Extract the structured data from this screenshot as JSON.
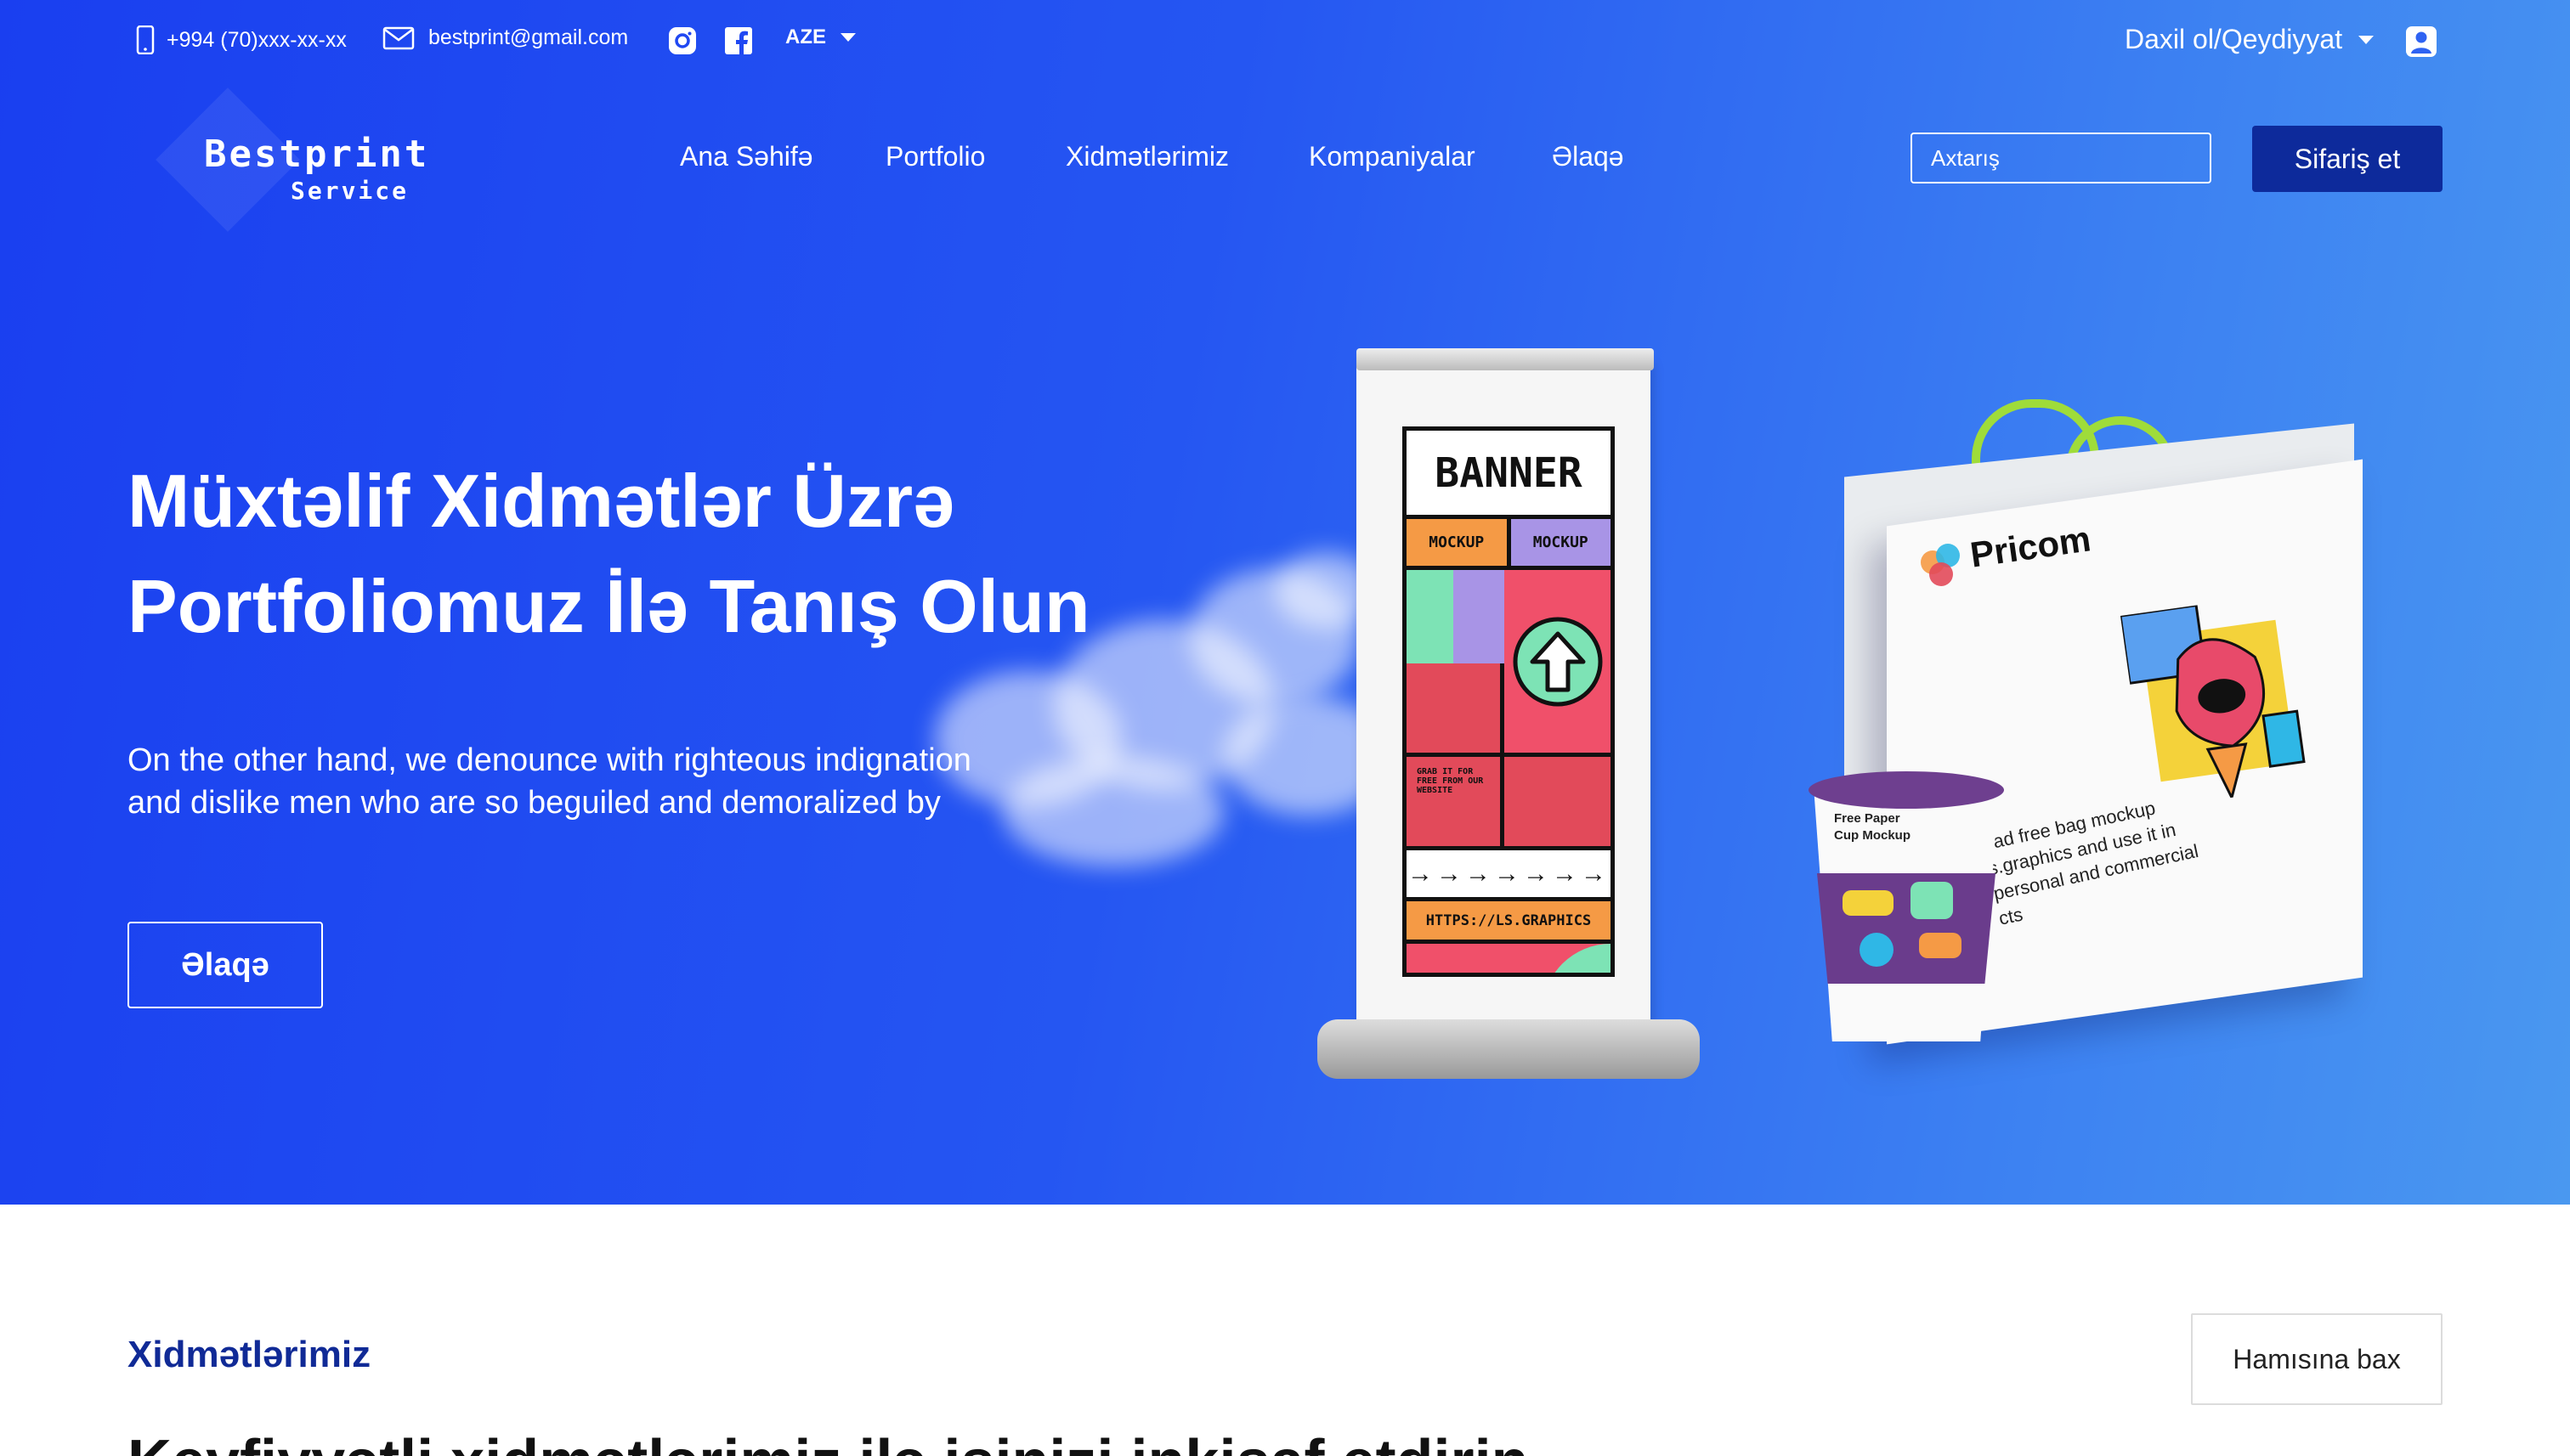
{
  "topbar": {
    "phone": "+994 (70)xxx-xx-xx",
    "email": "bestprint@gmail.com",
    "language": "AZE",
    "login": "Daxil ol/Qeydiyyat"
  },
  "logo": {
    "title": "Bestprint",
    "subtitle": "Service"
  },
  "nav": {
    "items": [
      {
        "label": "Ana Səhifə"
      },
      {
        "label": "Portfolio"
      },
      {
        "label": "Xidmətlərimiz"
      },
      {
        "label": "Kompaniyalar"
      },
      {
        "label": "Əlaqə"
      }
    ]
  },
  "search": {
    "placeholder": "Axtarış"
  },
  "order_button": "Sifariş et",
  "hero": {
    "title_line1": "Müxtəlif Xidmətlər Üzrə",
    "title_line2": "Portfoliomuz İlə Tanış Olun",
    "desc_line1": "On the other hand, we denounce with righteous indignation",
    "desc_line2": "and dislike men who are so beguiled and demoralized by",
    "button": "Əlaqə"
  },
  "banner": {
    "title": "BANNER",
    "tag1": "MOCKUP",
    "tag2": "MOCKUP",
    "small_text": "GRAB IT FOR FREE FROM OUR WEBSITE",
    "url": "HTTPS://LS.GRAPHICS"
  },
  "bag": {
    "brand": "Pricom",
    "text": "oad free bag mockup s.graphics and use it in personal and commercial cts"
  },
  "cup": {
    "label_line1": "Free Paper",
    "label_line2": "Cup Mockup"
  },
  "services": {
    "title": "Xidmətlərimiz",
    "see_all": "Hamısına bax",
    "subtitle": "Keyfiyyətli xidmətlərimiz ilə işinizi inkişaf etdirin"
  },
  "colors": {
    "hero_start": "#1a3ff0",
    "hero_end": "#4a98f0",
    "order_button": "#0d2a9b",
    "section_title": "#102a96"
  },
  "icons": {
    "phone": "phone-icon",
    "email": "mail-icon",
    "instagram": "instagram-icon",
    "facebook": "facebook-icon",
    "language": "chevron-down-icon",
    "user": "user-icon",
    "search": "search-icon"
  }
}
